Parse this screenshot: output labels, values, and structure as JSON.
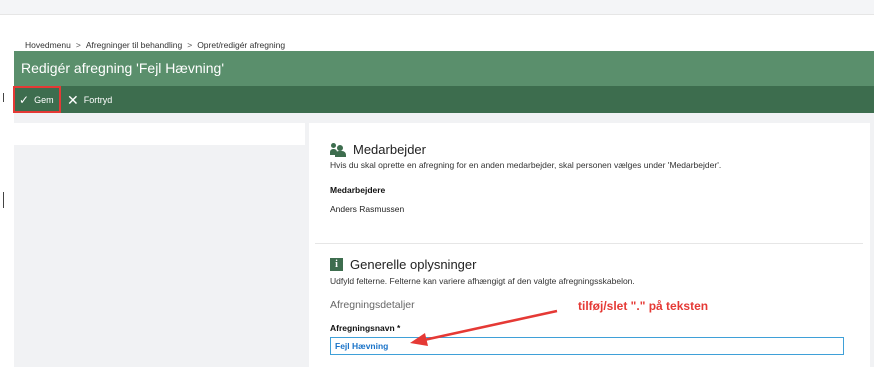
{
  "breadcrumb": {
    "items": [
      "Hovedmenu",
      "Afregninger til behandling",
      "Opret/redigér afregning"
    ],
    "separator": ">"
  },
  "page_title": "Redigér afregning 'Fejl Hævning'",
  "toolbar": {
    "save_label": "Gem",
    "save_icon": "checkmark-icon",
    "cancel_label": "Fortryd",
    "cancel_icon": "close-icon"
  },
  "medarbejder_section": {
    "icon": "people-icon",
    "title": "Medarbejder",
    "description": "Hvis du skal oprette en afregning for en anden medarbejder, skal personen vælges under 'Medarbejder'.",
    "field_label": "Medarbejdere",
    "field_value": "Anders Rasmussen"
  },
  "general_section": {
    "icon": "info-icon",
    "title": "Generelle oplysninger",
    "description": "Udfyld felterne. Felterne kan variere afhængigt af den valgte afregningsskabelon.",
    "subheading": "Afregningsdetaljer",
    "name_label": "Afregningsnavn *",
    "name_value": "Fejl Hævning"
  },
  "annotation": {
    "text": "tilføj/slet \".\" på teksten",
    "color": "#e53935"
  },
  "colors": {
    "title_bar": "#5a8f6c",
    "toolbar": "#3d6d4e",
    "highlight": "#e53935",
    "field_border": "#3fa0d8",
    "field_text": "#1a73c8"
  }
}
